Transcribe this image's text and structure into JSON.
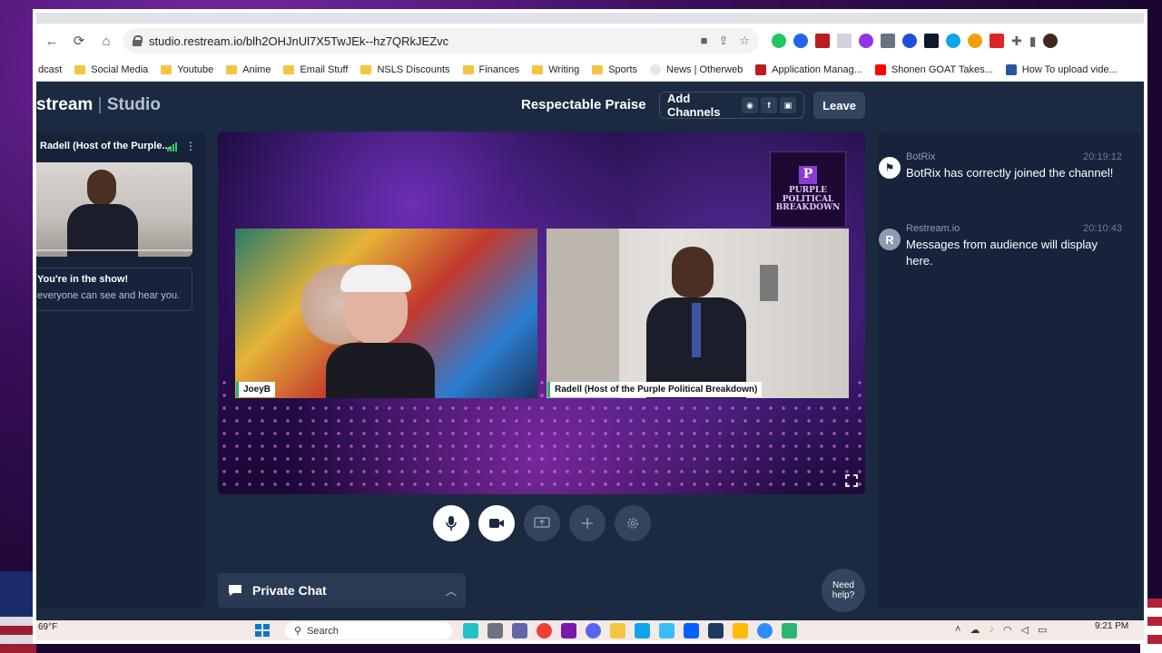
{
  "browser": {
    "url": "studio.restream.io/blh2OHJnUl7X5TwJEk--hz7QRkJEZvc",
    "bookmarks": [
      {
        "label": "dcast",
        "kind": "folder"
      },
      {
        "label": "Social Media",
        "kind": "folder"
      },
      {
        "label": "Youtube",
        "kind": "folder"
      },
      {
        "label": "Anime",
        "kind": "folder"
      },
      {
        "label": "Email Stuff",
        "kind": "folder"
      },
      {
        "label": "NSLS Discounts",
        "kind": "folder"
      },
      {
        "label": "Finances",
        "kind": "folder"
      },
      {
        "label": "Writing",
        "kind": "folder"
      },
      {
        "label": "Sports",
        "kind": "folder"
      },
      {
        "label": "News | Otherweb",
        "kind": "site"
      },
      {
        "label": "Application Manag...",
        "kind": "site"
      },
      {
        "label": "Shonen GOAT Takes...",
        "kind": "site"
      },
      {
        "label": "How To upload vide...",
        "kind": "site"
      }
    ]
  },
  "studio": {
    "brand_left": "stream",
    "brand_sep": "|",
    "brand_right": "Studio",
    "stream_title": "Respectable Praise",
    "add_channels_label": "Add Channels",
    "leave_label": "Leave",
    "preview_name": "Radell (Host of the Purple...",
    "in_show_title": "You're in the show!",
    "in_show_sub": "everyone can see and hear you.",
    "logo_lines": [
      "PURPLE",
      "POLITICAL",
      "BREAKDOWN"
    ],
    "tiles": [
      {
        "label": "JoeyB"
      },
      {
        "label": "Radell (Host of the Purple Political Breakdown)"
      }
    ],
    "private_chat_label": "Private Chat",
    "need_help_label": "Need help?"
  },
  "chat": {
    "messages": [
      {
        "name": "BotRix",
        "time": "20:19:12",
        "text": "BotRix has correctly joined the channel!",
        "avatar_color": "#ffffff"
      },
      {
        "name": "Restream.io",
        "time": "20:10:43",
        "text": "Messages from audience will display here.",
        "avatar_color": "#8e9bb3"
      }
    ]
  },
  "taskbar": {
    "weather": "69°F",
    "search_placeholder": "Search",
    "time": "9:21 PM"
  },
  "colors": {
    "studio_bg": "#1b2a41",
    "panel_bg": "#16233a",
    "accent_green": "#2bb673"
  }
}
